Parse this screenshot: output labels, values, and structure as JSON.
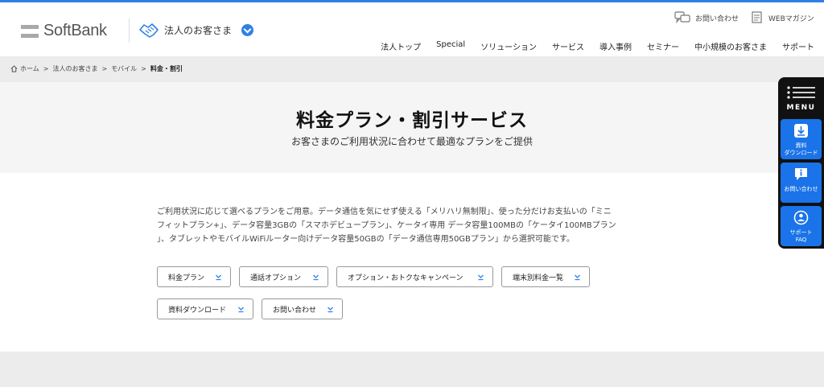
{
  "brand": {
    "name": "SoftBank"
  },
  "header": {
    "segment_label": "法人のお客さま",
    "utility": {
      "contact": "お問い合わせ",
      "magazine": "WEBマガジン"
    },
    "nav": [
      "法人トップ",
      "Special",
      "ソリューション",
      "サービス",
      "導入事例",
      "セミナー",
      "中小規模のお客さま",
      "サポート"
    ]
  },
  "breadcrumb": [
    "ホーム",
    "法人のお客さま",
    "モバイル",
    "料金・割引"
  ],
  "hero": {
    "title": "料金プラン・割引サービス",
    "subtitle": "お客さまのご利用状況に合わせて最適なプランをご提供"
  },
  "intro": {
    "line1": "ご利用状況に応じて選べるプランをご用意。データ通信を気にせず使える「メリハリ無制限」、使った分だけお支払いの「ミニ",
    "line2": "フィットプラン+」、データ容量3GBの「スマホデビュープラン」、ケータイ専用 データ容量100MBの「ケータイ100MBプラン",
    "line3": "」、タブレットやモバイルWiFiルーター向けデータ容量50GBの「データ通信専用50GBプラン」から選択可能です。"
  },
  "anchors": [
    "料金プラン",
    "通話オプション",
    "オプション・おトクなキャンペーン",
    "端末別料金一覧",
    "資料ダウンロード",
    "お問い合わせ"
  ],
  "side_menu": {
    "menu_label": "MENU",
    "download": "資料\nダウンロード",
    "contact": "お問い合わせ",
    "faq": "サポート\nFAQ"
  },
  "colors": {
    "accent": "#2f80e5",
    "side_button": "#1a73e8"
  }
}
